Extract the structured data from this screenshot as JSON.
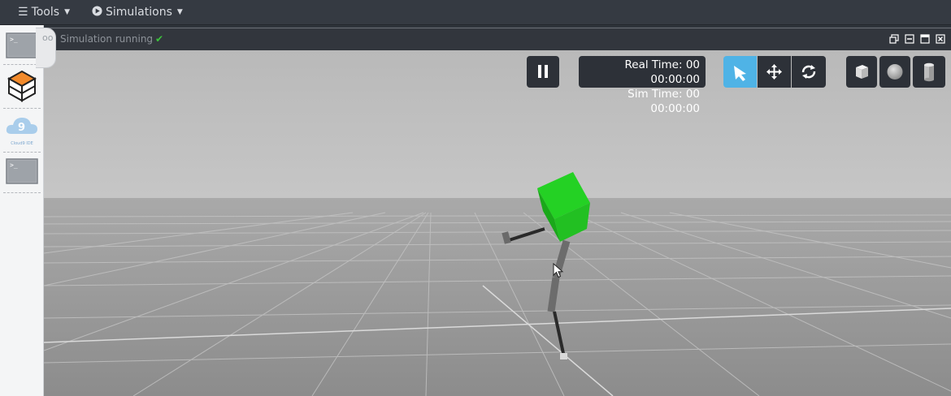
{
  "menubar": {
    "tools_label": "Tools",
    "simulations_label": "Simulations"
  },
  "window": {
    "title": "Simulation running",
    "title_status_icon": "check-icon"
  },
  "sidebar": {
    "items": [
      {
        "name": "terminal",
        "icon": "terminal-icon"
      },
      {
        "name": "gazebo",
        "icon": "gazebo-icon"
      },
      {
        "name": "cloud9",
        "icon": "cloud9-icon",
        "label": "Cloud9 IDE"
      },
      {
        "name": "terminal-2",
        "icon": "terminal-icon"
      }
    ]
  },
  "toolbar": {
    "pause_icon": "pause-icon",
    "real_time_label": "Real Time:",
    "real_time_value": "00 00:00:00",
    "sim_time_label": "Sim Time:",
    "sim_time_value": "00 00:00:00",
    "modes": [
      {
        "name": "select",
        "icon": "select-arrow-icon",
        "active": true
      },
      {
        "name": "translate",
        "icon": "move-icon",
        "active": false
      },
      {
        "name": "rotate",
        "icon": "rotate-icon",
        "active": false
      }
    ],
    "shapes": [
      {
        "name": "box",
        "icon": "cube-icon"
      },
      {
        "name": "sphere",
        "icon": "sphere-icon"
      },
      {
        "name": "cylinder",
        "icon": "cylinder-icon"
      }
    ]
  },
  "colors": {
    "accent": "#4fb3e6",
    "robot_body": "#2ecc2e",
    "running_check": "#3cc43c"
  }
}
